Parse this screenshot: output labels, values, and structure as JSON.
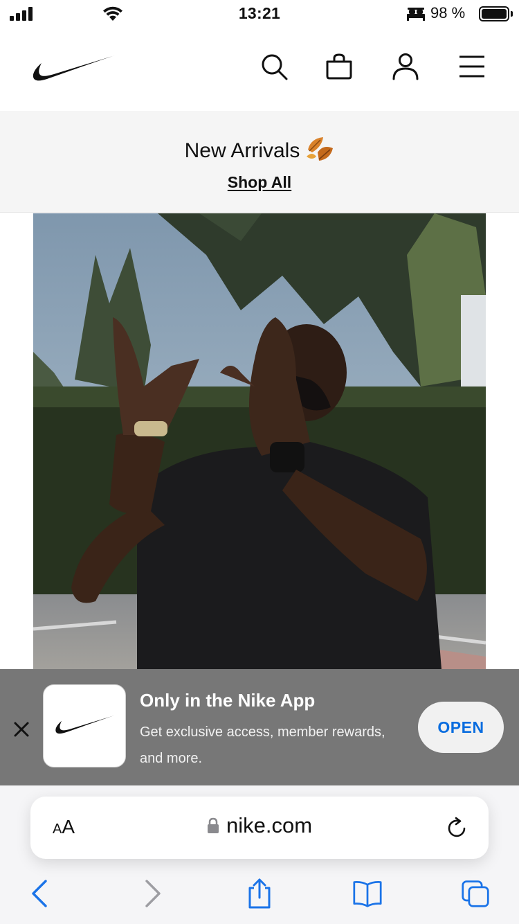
{
  "status_bar": {
    "time": "13:21",
    "battery": "98 %",
    "icons": [
      "cellular-signal-icon",
      "wifi-icon",
      "sleep-mode-icon",
      "battery-icon"
    ]
  },
  "header": {
    "logo": "nike-swoosh-logo",
    "icons": [
      "search-icon",
      "bag-icon",
      "account-icon",
      "menu-icon"
    ]
  },
  "promo": {
    "title": "New Arrivals",
    "emoji": "leaf-icon",
    "link": "Shop All"
  },
  "hero": {
    "image": "man-looking-up-on-basketball-court"
  },
  "app_banner": {
    "title": "Only in the Nike App",
    "description": "Get exclusive access, member rewards, and more.",
    "button": "OPEN",
    "accent_color": "#0a6ddf"
  },
  "safari": {
    "text_size_button": "AA",
    "url": "nike.com",
    "toolbar": [
      "back-icon",
      "forward-icon",
      "share-icon",
      "bookmarks-icon",
      "tabs-icon"
    ]
  }
}
